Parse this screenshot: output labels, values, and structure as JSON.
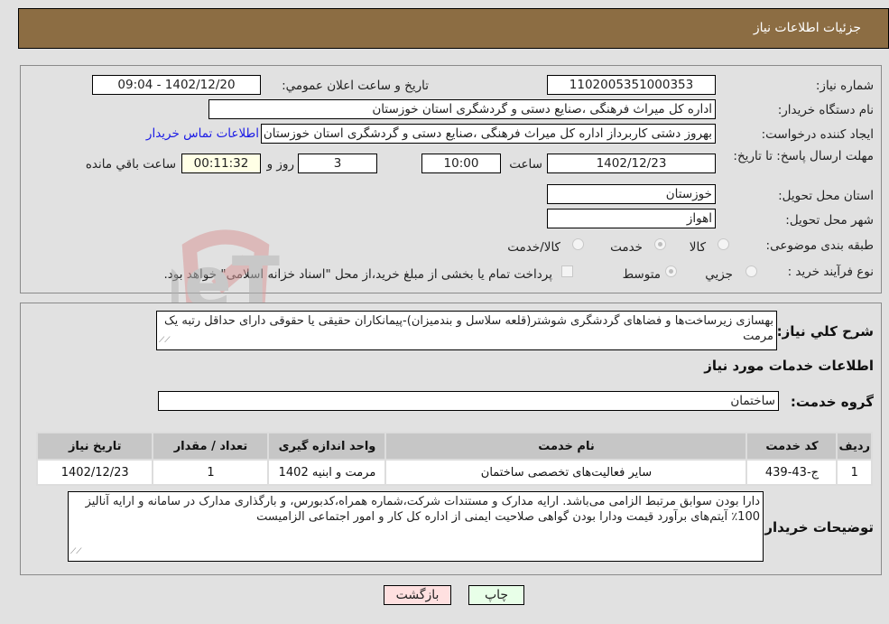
{
  "header": {
    "title": "جزئیات اطلاعات نیاز"
  },
  "form": {
    "need_number": {
      "label": "شماره نیاز:",
      "value": "1102005351000353"
    },
    "announce_datetime": {
      "label": "تاریخ و ساعت اعلان عمومي:",
      "value": "1402/12/20 - 09:04"
    },
    "buyer_org": {
      "label": "نام دستگاه خریدار:",
      "value": "اداره کل میراث فرهنگی ،صنایع دستی و گردشگری استان خوزستان"
    },
    "requester": {
      "label": "ایجاد کننده درخواست:",
      "value": "بهروز دشتی کاربرداز اداره کل میراث فرهنگی ،صنایع دستی و گردشگری استان خوزستان",
      "contact_link": "اطلاعات تماس خریدار"
    },
    "deadline": {
      "label": "مهلت ارسال پاسخ: تا تاریخ:",
      "date": "1402/12/23",
      "time_label": "ساعت",
      "time": "10:00",
      "days": "3",
      "days_label": "روز و",
      "remaining": "00:11:32",
      "remaining_label": "ساعت باقي مانده"
    },
    "province": {
      "label": "استان محل تحویل:",
      "value": "خوزستان"
    },
    "city": {
      "label": "شهر محل تحویل:",
      "value": "اهواز"
    },
    "category": {
      "label": "طبقه بندی موضوعی:",
      "options": [
        "کالا",
        "خدمت",
        "کالا/خدمت"
      ],
      "selected": "خدمت"
    },
    "process_type": {
      "label": "نوع فرآیند خرید :",
      "options": [
        "جزيي",
        "متوسط"
      ],
      "selected": "متوسط",
      "treasury_note": "پرداخت تمام یا بخشی از مبلغ خرید،از محل \"اسناد خزانه اسلامی\" خواهد بود."
    }
  },
  "details": {
    "description_label": "شرح کلي نیاز:",
    "description": "بهسازی زیرساخت‌ها و فضاهای گردشگری شوشتر(قلعه سلاسل و بندمیزان)-پیمانکاران حقیقی یا حقوقی دارای حداقل رتبه یک مرمت",
    "services_heading": "اطلاعات خدمات مورد نیاز",
    "service_group_label": "گروه خدمت:",
    "service_group": "ساختمان",
    "table": {
      "headers": [
        "ردیف",
        "کد خدمت",
        "نام خدمت",
        "واحد اندازه گیری",
        "تعداد / مقدار",
        "تاریخ نیاز"
      ],
      "rows": [
        [
          "1",
          "ج-43-439",
          "سایر فعالیت‌های تخصصی ساختمان",
          "مرمت و ابنیه 1402",
          "1",
          "1402/12/23"
        ]
      ]
    },
    "buyer_notes_label": "توضیحات خریدار:",
    "buyer_notes": "دارا بودن سوابق مرتبط الزامی می‌باشد. ارایه مدارک و مستندات شرکت،شماره همراه،کدبورس، و بارگذاری مدارک در سامانه و ارایه آنالیز 100٪ آیتم‌های برآورد قیمت ودارا بودن گواهی صلاحیت ایمنی از اداره کل کار و امور اجتماعی الزامیست"
  },
  "buttons": {
    "print": "چاپ",
    "back": "بازگشت"
  },
  "watermark": {
    "text": "AriaTender.neT"
  },
  "colors": {
    "header_bg": "#8c6d43",
    "back_btn": "#ffe0e0",
    "print_btn": "#e8ffe8",
    "link": "#1a1ae6"
  }
}
